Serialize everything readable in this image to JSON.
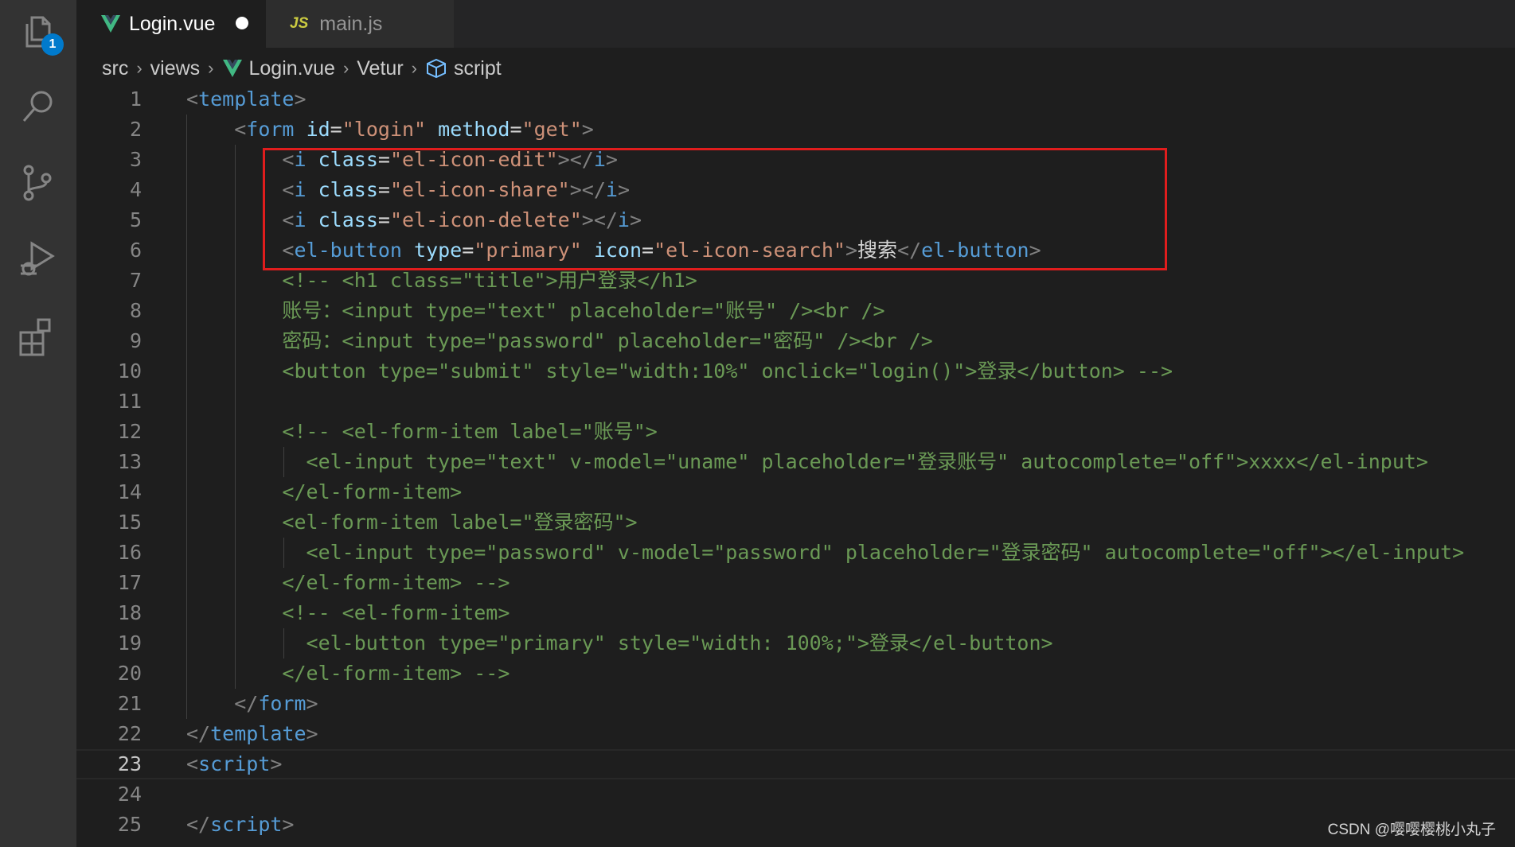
{
  "activity_bar": {
    "explorer_badge": "1",
    "items": [
      "explorer-icon",
      "search-icon",
      "source-control-icon",
      "run-debug-icon",
      "extensions-icon"
    ]
  },
  "tabs": [
    {
      "label": "Login.vue",
      "icon": "vue-icon",
      "active": true,
      "modified": true
    },
    {
      "label": "main.js",
      "icon": "js-icon",
      "icon_text": "JS",
      "active": false,
      "modified": false
    }
  ],
  "breadcrumb": [
    "src",
    "views",
    "Login.vue",
    "Vetur",
    "script"
  ],
  "editor": {
    "current_line": 23,
    "line_numbers": [
      "1",
      "2",
      "3",
      "4",
      "5",
      "6",
      "7",
      "8",
      "9",
      "10",
      "11",
      "12",
      "13",
      "14",
      "15",
      "16",
      "17",
      "18",
      "19",
      "20",
      "21",
      "22",
      "23",
      "24",
      "25"
    ],
    "lines": [
      [
        [
          "punc",
          "<"
        ],
        [
          "tag",
          "template"
        ],
        [
          "punc",
          ">"
        ]
      ],
      [
        [
          "text",
          "    "
        ],
        [
          "punc",
          "<"
        ],
        [
          "tag",
          "form"
        ],
        [
          "text",
          " "
        ],
        [
          "attr",
          "id"
        ],
        [
          "text",
          "="
        ],
        [
          "str",
          "\"login\""
        ],
        [
          "text",
          " "
        ],
        [
          "attr",
          "method"
        ],
        [
          "text",
          "="
        ],
        [
          "str",
          "\"get\""
        ],
        [
          "punc",
          ">"
        ]
      ],
      [
        [
          "text",
          "        "
        ],
        [
          "punc",
          "<"
        ],
        [
          "tag",
          "i"
        ],
        [
          "text",
          " "
        ],
        [
          "attr",
          "class"
        ],
        [
          "text",
          "="
        ],
        [
          "str",
          "\"el-icon-edit\""
        ],
        [
          "punc",
          "></"
        ],
        [
          "tag",
          "i"
        ],
        [
          "punc",
          ">"
        ]
      ],
      [
        [
          "text",
          "        "
        ],
        [
          "punc",
          "<"
        ],
        [
          "tag",
          "i"
        ],
        [
          "text",
          " "
        ],
        [
          "attr",
          "class"
        ],
        [
          "text",
          "="
        ],
        [
          "str",
          "\"el-icon-share\""
        ],
        [
          "punc",
          "></"
        ],
        [
          "tag",
          "i"
        ],
        [
          "punc",
          ">"
        ]
      ],
      [
        [
          "text",
          "        "
        ],
        [
          "punc",
          "<"
        ],
        [
          "tag",
          "i"
        ],
        [
          "text",
          " "
        ],
        [
          "attr",
          "class"
        ],
        [
          "text",
          "="
        ],
        [
          "str",
          "\"el-icon-delete\""
        ],
        [
          "punc",
          "></"
        ],
        [
          "tag",
          "i"
        ],
        [
          "punc",
          ">"
        ]
      ],
      [
        [
          "text",
          "        "
        ],
        [
          "punc",
          "<"
        ],
        [
          "tag",
          "el-button"
        ],
        [
          "text",
          " "
        ],
        [
          "attr",
          "type"
        ],
        [
          "text",
          "="
        ],
        [
          "str",
          "\"primary\""
        ],
        [
          "text",
          " "
        ],
        [
          "attr",
          "icon"
        ],
        [
          "text",
          "="
        ],
        [
          "str",
          "\"el-icon-search\""
        ],
        [
          "punc",
          ">"
        ],
        [
          "text",
          "搜索"
        ],
        [
          "punc",
          "</"
        ],
        [
          "tag",
          "el-button"
        ],
        [
          "punc",
          ">"
        ]
      ],
      [
        [
          "text",
          "        "
        ],
        [
          "comment",
          "<!-- <h1 class=\"title\">用户登录</h1>"
        ]
      ],
      [
        [
          "text",
          "        "
        ],
        [
          "comment",
          "账号：<input type=\"text\" placeholder=\"账号\" /><br />"
        ]
      ],
      [
        [
          "text",
          "        "
        ],
        [
          "comment",
          "密码：<input type=\"password\" placeholder=\"密码\" /><br />"
        ]
      ],
      [
        [
          "text",
          "        "
        ],
        [
          "comment",
          "<button type=\"submit\" style=\"width:10%\" onclick=\"login()\">登录</button> -->"
        ]
      ],
      [],
      [
        [
          "text",
          "        "
        ],
        [
          "comment",
          "<!-- <el-form-item label=\"账号\">"
        ]
      ],
      [
        [
          "text",
          "          "
        ],
        [
          "comment",
          "<el-input type=\"text\" v-model=\"uname\" placeholder=\"登录账号\" autocomplete=\"off\">xxxx</el-input>"
        ]
      ],
      [
        [
          "text",
          "        "
        ],
        [
          "comment",
          "</el-form-item>"
        ]
      ],
      [
        [
          "text",
          "        "
        ],
        [
          "comment",
          "<el-form-item label=\"登录密码\">"
        ]
      ],
      [
        [
          "text",
          "          "
        ],
        [
          "comment",
          "<el-input type=\"password\" v-model=\"password\" placeholder=\"登录密码\" autocomplete=\"off\"></el-input>"
        ]
      ],
      [
        [
          "text",
          "        "
        ],
        [
          "comment",
          "</el-form-item> -->"
        ]
      ],
      [
        [
          "text",
          "        "
        ],
        [
          "comment",
          "<!-- <el-form-item>"
        ]
      ],
      [
        [
          "text",
          "          "
        ],
        [
          "comment",
          "<el-button type=\"primary\" style=\"width: 100%;\">登录</el-button>"
        ]
      ],
      [
        [
          "text",
          "        "
        ],
        [
          "comment",
          "</el-form-item> -->"
        ]
      ],
      [
        [
          "text",
          "    "
        ],
        [
          "punc",
          "</"
        ],
        [
          "tag",
          "form"
        ],
        [
          "punc",
          ">"
        ]
      ],
      [
        [
          "punc",
          "</"
        ],
        [
          "tag",
          "template"
        ],
        [
          "punc",
          ">"
        ]
      ],
      [
        [
          "punc",
          "<"
        ],
        [
          "tag",
          "script"
        ],
        [
          "punc",
          ">"
        ]
      ],
      [],
      [
        [
          "punc",
          "</"
        ],
        [
          "tag",
          "script"
        ],
        [
          "punc",
          ">"
        ]
      ]
    ]
  },
  "watermark": "CSDN @嘤嘤樱桃小丸子",
  "colors": {
    "background": "#1e1e1e",
    "activity_bar": "#333333",
    "tab_bar": "#252526",
    "tag": "#569cd6",
    "attribute": "#9cdcfe",
    "string": "#ce9178",
    "comment": "#6a9955",
    "highlight_box": "#e01d1d",
    "badge": "#007acc"
  }
}
